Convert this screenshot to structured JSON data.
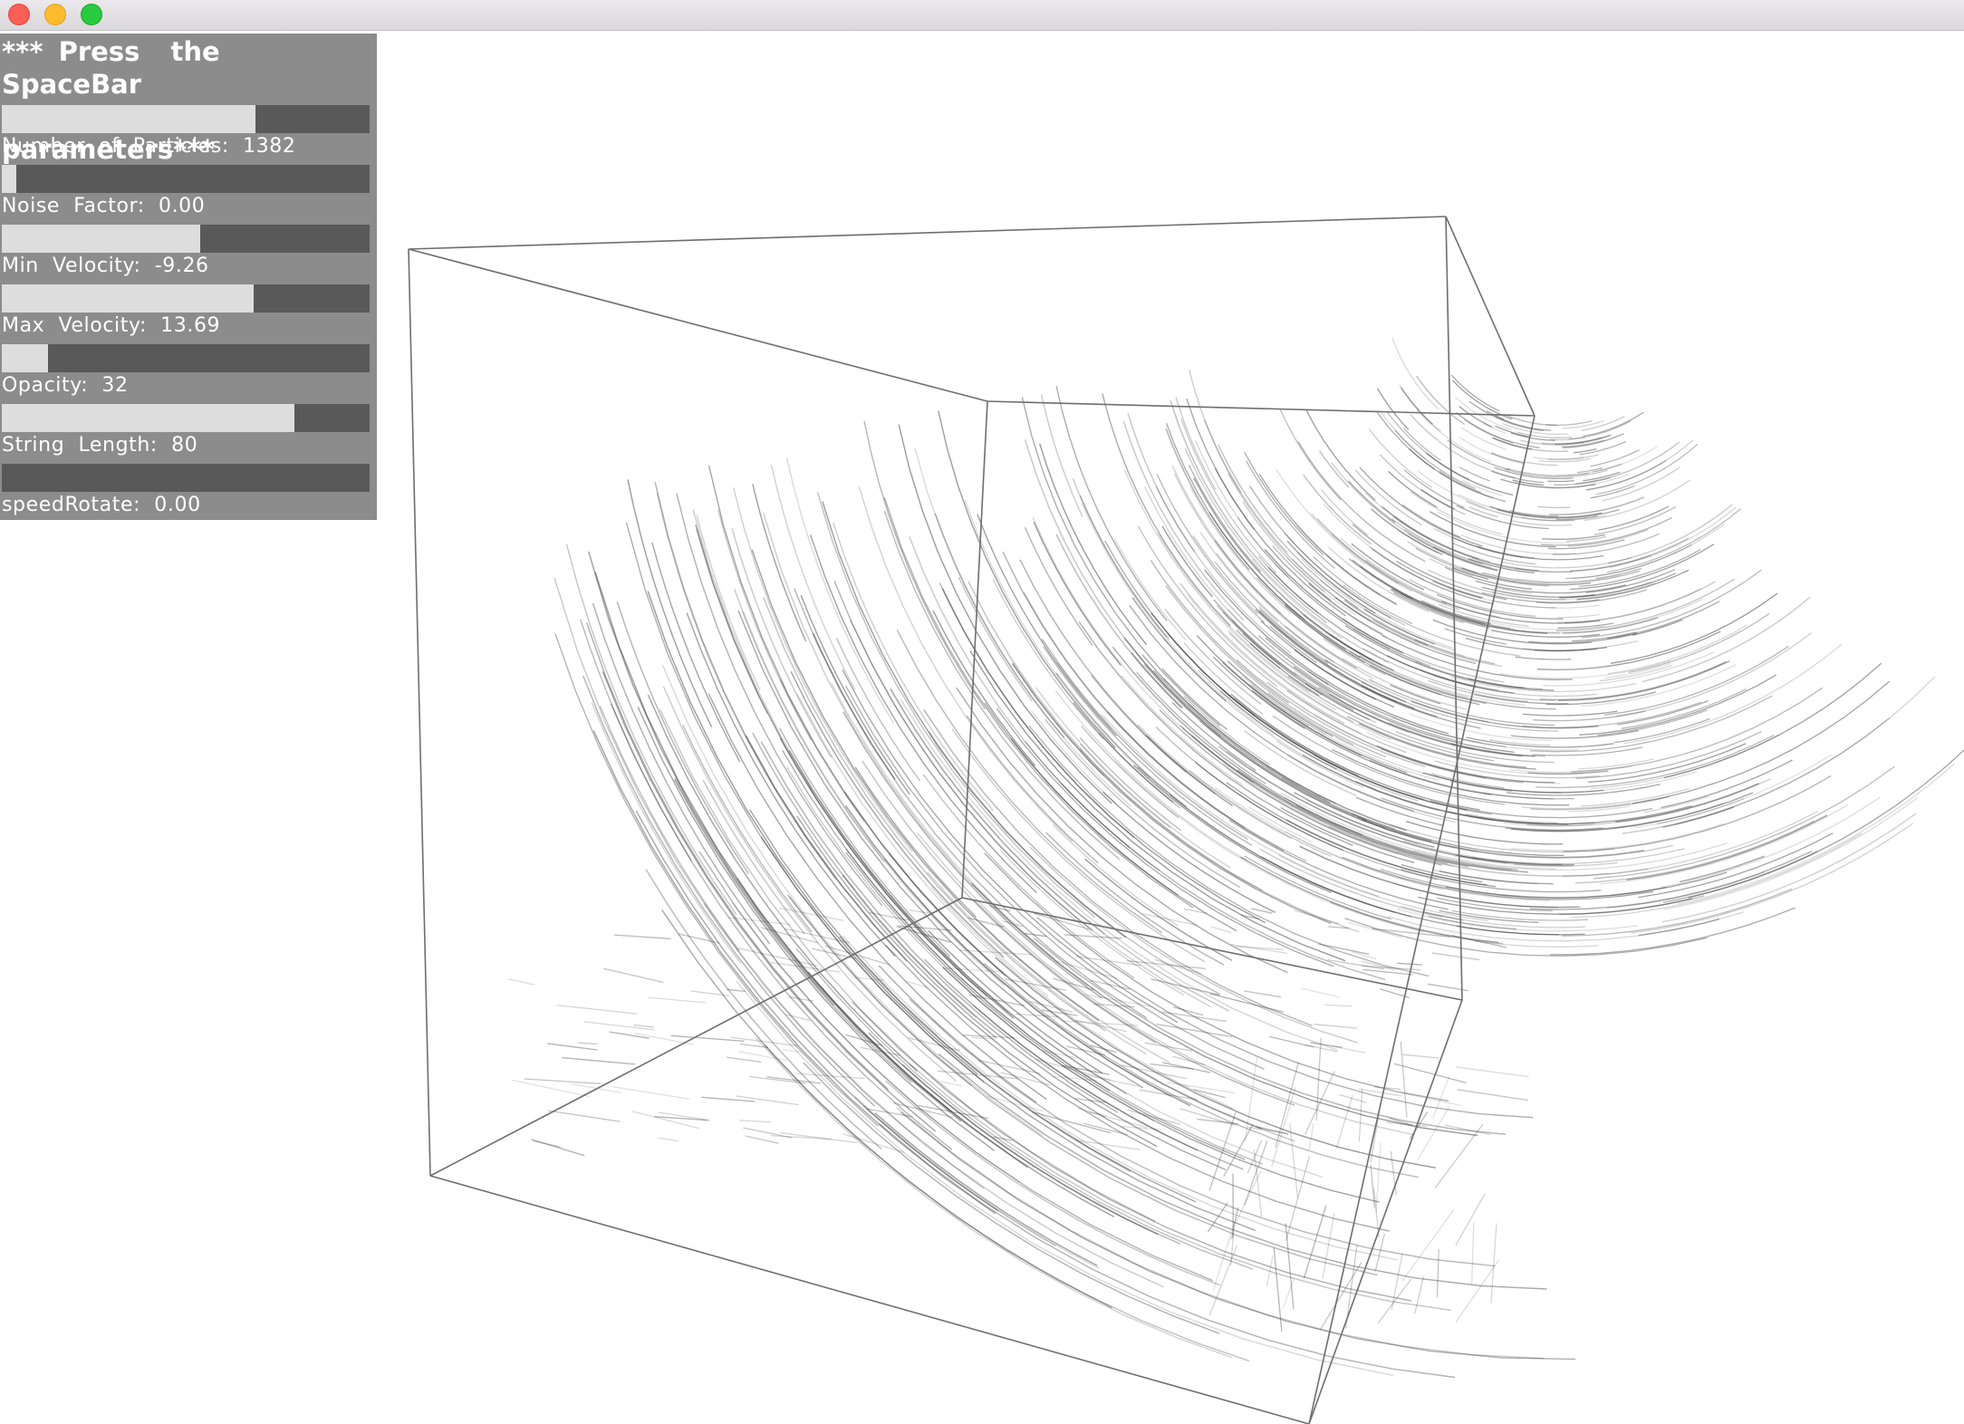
{
  "window": {
    "buttons": [
      "close",
      "minimize",
      "zoom"
    ],
    "colors": {
      "close": "#fc5f57",
      "minimize": "#fdbc2e",
      "zoom": "#29c940"
    }
  },
  "panel": {
    "heading": "*** Press  the  SpaceBar\nto  update  parameters***",
    "colors": {
      "background": "#8c8c8c",
      "track": "#595959",
      "fill": "#dddddd",
      "text": "#ffffff"
    },
    "sliders": [
      {
        "label": "Number  of  Particles:  1382",
        "fill_fraction": 0.69
      },
      {
        "label": "Noise  Factor:  0.00",
        "fill_fraction": 0.04
      },
      {
        "label": "Min  Velocity:  -9.26",
        "fill_fraction": 0.54
      },
      {
        "label": "Max  Velocity:  13.69",
        "fill_fraction": 0.685
      },
      {
        "label": "Opacity:  32",
        "fill_fraction": 0.125
      },
      {
        "label": "String  Length:  80",
        "fill_fraction": 0.795
      },
      {
        "label": "speedRotate:  0.00",
        "fill_fraction": 0.0
      }
    ]
  },
  "scene": {
    "background": "#ffffff",
    "box_edge_color": "#6e6e6e",
    "particle_color": "#333333",
    "particle_count_shown": 1382,
    "string_length": 80
  }
}
